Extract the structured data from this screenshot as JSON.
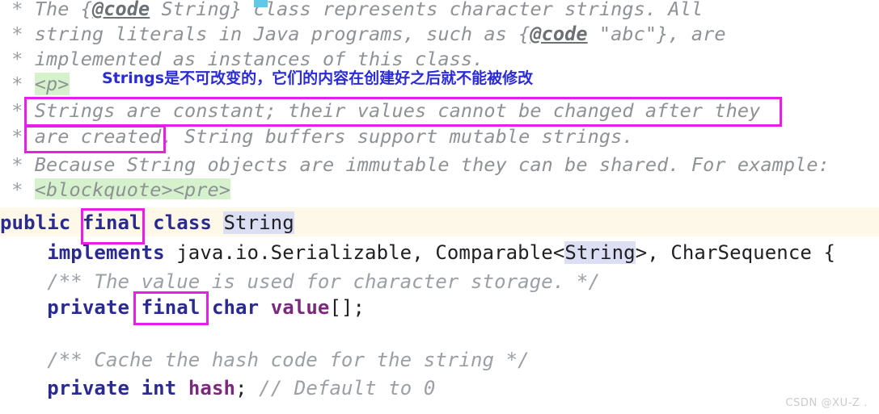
{
  "file": {
    "language": "java",
    "class_name": "String"
  },
  "colors": {
    "background": "#ffffff",
    "comment_text": "#8e9196",
    "keyword": "#2b2b8f",
    "field_name": "#7a2a7a",
    "plain_code": "#202124",
    "annotation_box": "#e81ee8",
    "annotation_note": "#2b2bd8",
    "green_highlight": "#d6f2cc",
    "selection_highlight": "#dcdff4",
    "current_line": "#fdf8e8",
    "watermark": "#c9cbcd"
  },
  "javadoc": {
    "lines": [
      {
        "star": "*",
        "segments": [
          {
            "text": " The {",
            "style": "italic"
          },
          {
            "text": "@code",
            "style": "codetag"
          },
          {
            "text": " String} class represents character strings. All",
            "style": "italic"
          }
        ]
      },
      {
        "star": "*",
        "segments": [
          {
            "text": " string literals in Java programs, such as {",
            "style": "italic"
          },
          {
            "text": "@code",
            "style": "codetag"
          },
          {
            "text": " \"abc\"}, are",
            "style": "italic"
          }
        ]
      },
      {
        "star": "*",
        "segments": [
          {
            "text": " implemented as instances of this class.",
            "style": "italic"
          }
        ]
      },
      {
        "star": "*",
        "segments": [
          {
            "text": " ",
            "style": "italic"
          },
          {
            "text": "<p>",
            "style": "green"
          }
        ]
      },
      {
        "star": "*",
        "segments": [
          {
            "text": " Strings are constant; their values cannot be changed after they",
            "style": "italic"
          }
        ]
      },
      {
        "star": "*",
        "segments": [
          {
            "text": " are created. String buffers support mutable strings.",
            "style": "italic"
          }
        ]
      },
      {
        "star": "*",
        "segments": [
          {
            "text": " Because String objects are immutable they can be shared. For example:",
            "style": "italic"
          }
        ]
      },
      {
        "star": "*",
        "segments": [
          {
            "text": " ",
            "style": "italic"
          },
          {
            "text": "<blockquote><pre>",
            "style": "green"
          }
        ]
      }
    ]
  },
  "code": {
    "lines": [
      {
        "id": "class-declaration",
        "current_line": true,
        "segments": [
          {
            "text": "public",
            "style": "kw"
          },
          {
            "text": " ",
            "style": "plain"
          },
          {
            "text": "final",
            "style": "kw"
          },
          {
            "text": " ",
            "style": "plain"
          },
          {
            "text": "class",
            "style": "kw"
          },
          {
            "text": " ",
            "style": "plain"
          },
          {
            "text": "String",
            "style": "sel"
          }
        ]
      },
      {
        "id": "implements-clause",
        "current_line": false,
        "segments": [
          {
            "text": "    ",
            "style": "plain"
          },
          {
            "text": "implements",
            "style": "kw"
          },
          {
            "text": " java.io.Serializable, Comparable<",
            "style": "plain"
          },
          {
            "text": "String",
            "style": "sel"
          },
          {
            "text": ">, CharSequence {",
            "style": "plain"
          }
        ]
      },
      {
        "id": "value-doc-comment",
        "current_line": false,
        "segments": [
          {
            "text": "    ",
            "style": "plain"
          },
          {
            "text": "/** The value is used for character storage. */",
            "style": "cmt"
          }
        ]
      },
      {
        "id": "value-field",
        "current_line": false,
        "segments": [
          {
            "text": "    ",
            "style": "plain"
          },
          {
            "text": "private",
            "style": "kw"
          },
          {
            "text": " ",
            "style": "plain"
          },
          {
            "text": "final",
            "style": "kw"
          },
          {
            "text": " ",
            "style": "plain"
          },
          {
            "text": "char",
            "style": "kw"
          },
          {
            "text": " ",
            "style": "plain"
          },
          {
            "text": "value",
            "style": "field"
          },
          {
            "text": "[];",
            "style": "plain"
          }
        ]
      },
      {
        "id": "blank-line",
        "current_line": false,
        "segments": [
          {
            "text": "",
            "style": "plain"
          }
        ]
      },
      {
        "id": "hash-doc-comment",
        "current_line": false,
        "segments": [
          {
            "text": "    ",
            "style": "plain"
          },
          {
            "text": "/** Cache the hash code for the string */",
            "style": "cmt"
          }
        ]
      },
      {
        "id": "hash-field",
        "current_line": false,
        "segments": [
          {
            "text": "    ",
            "style": "plain"
          },
          {
            "text": "private",
            "style": "kw"
          },
          {
            "text": " ",
            "style": "plain"
          },
          {
            "text": "int",
            "style": "kw"
          },
          {
            "text": " ",
            "style": "plain"
          },
          {
            "text": "hash",
            "style": "field"
          },
          {
            "text": "; ",
            "style": "plain"
          },
          {
            "text": "// Default to 0",
            "style": "cmt"
          }
        ]
      }
    ]
  },
  "annotations": {
    "note": "Strings是不可改变的，它们的内容在创建好之后就不能被修改",
    "boxes": [
      {
        "id": "box-strings-are-constant",
        "target": "Strings are constant; their values cannot be changed after they"
      },
      {
        "id": "box-are-created",
        "target": "are created."
      },
      {
        "id": "box-final-class",
        "target": "final"
      },
      {
        "id": "box-final-field",
        "target": "final"
      }
    ]
  },
  "watermark": {
    "text": "CSDN @XU-Z ."
  }
}
